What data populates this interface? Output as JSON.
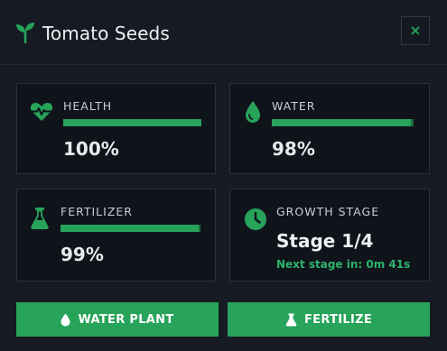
{
  "window": {
    "title": "Tomato Seeds",
    "close_label": "×"
  },
  "stats": {
    "health": {
      "label": "HEALTH",
      "value": "100%",
      "level": 1.0,
      "icon": "heartbeat-icon"
    },
    "water": {
      "label": "WATER",
      "value": "98%",
      "level": 0.98,
      "icon": "water-drop-icon"
    },
    "fertilizer": {
      "label": "FERTILIZER",
      "value": "99%",
      "level": 0.99,
      "icon": "flask-icon"
    }
  },
  "growth": {
    "label": "GROWTH STAGE",
    "stage": "Stage 1/4",
    "next": "Next stage in: 0m 41s",
    "icon": "clock-icon"
  },
  "actions": {
    "water_label": "WATER PLANT",
    "fertilize_label": "FERTILIZE"
  },
  "colors": {
    "accent": "#27a35a",
    "bar_track": "#1f6b3e",
    "background": "#161b23",
    "card": "#0f141b"
  }
}
